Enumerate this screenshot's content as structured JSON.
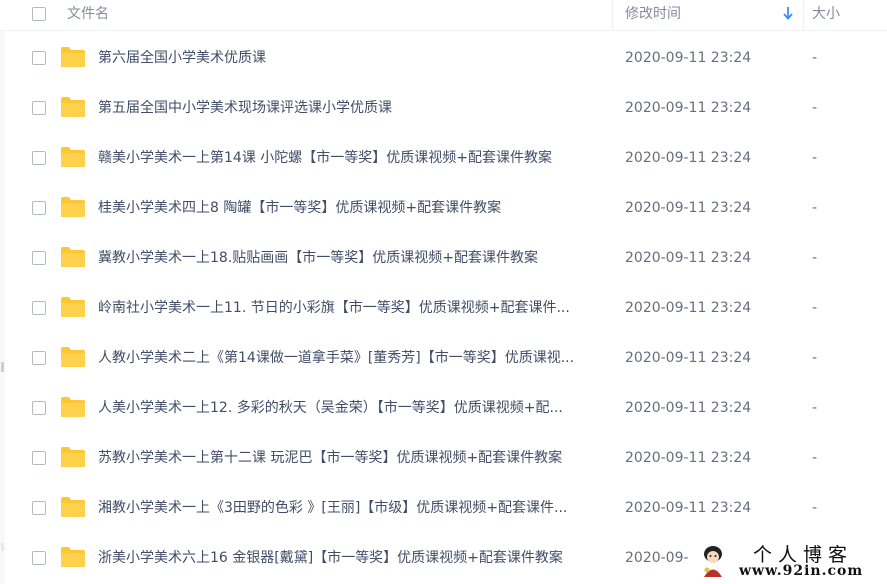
{
  "header": {
    "name_label": "文件名",
    "modified_label": "修改时间",
    "size_label": "大小",
    "sort_icon": "arrow-down-icon"
  },
  "accent_color": "#3b8cff",
  "folder_color": "#ffc634",
  "files": [
    {
      "name": "第六届全国小学美术优质课",
      "modified": "2020-09-11 23:24",
      "size": "-"
    },
    {
      "name": "第五届全国中小学美术现场课评选课小学优质课",
      "modified": "2020-09-11 23:24",
      "size": "-"
    },
    {
      "name": "赣美小学美术一上第14课 小陀螺【市一等奖】优质课视频+配套课件教案",
      "modified": "2020-09-11 23:24",
      "size": "-"
    },
    {
      "name": "桂美小学美术四上8 陶罐【市一等奖】优质课视频+配套课件教案",
      "modified": "2020-09-11 23:24",
      "size": "-"
    },
    {
      "name": "冀教小学美术一上18.贴贴画画【市一等奖】优质课视频+配套课件教案",
      "modified": "2020-09-11 23:24",
      "size": "-"
    },
    {
      "name": "岭南社小学美术一上11. 节日的小彩旗【市一等奖】优质课视频+配套课件...",
      "modified": "2020-09-11 23:24",
      "size": "-"
    },
    {
      "name": "人教小学美术二上《第14课做一道拿手菜》[董秀芳]【市一等奖】优质课视...",
      "modified": "2020-09-11 23:24",
      "size": "-"
    },
    {
      "name": "人美小学美术一上12. 多彩的秋天（吴金荣）【市一等奖】优质课视频+配...",
      "modified": "2020-09-11 23:24",
      "size": "-"
    },
    {
      "name": "苏教小学美术一上第十二课 玩泥巴【市一等奖】优质课视频+配套课件教案",
      "modified": "2020-09-11 23:24",
      "size": "-"
    },
    {
      "name": "湘教小学美术一上《3田野的色彩 》[王丽]【市级】优质课视频+配套课件...",
      "modified": "2020-09-11 23:24",
      "size": "-"
    },
    {
      "name": "浙美小学美术六上16 金银器[戴黛]【市一等奖】优质课视频+配套课件教案",
      "modified": "2020-09-",
      "size": "-"
    }
  ],
  "watermark": {
    "title": "个人博客",
    "url": "www.92in.com"
  }
}
